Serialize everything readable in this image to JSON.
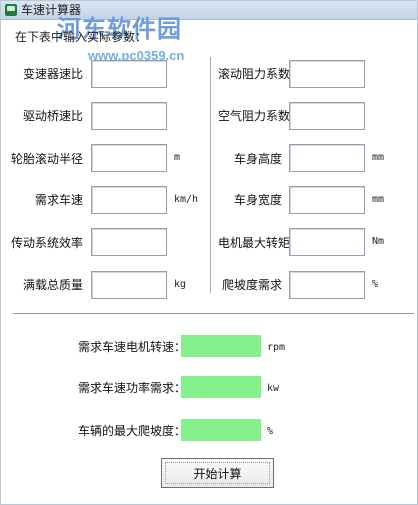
{
  "window": {
    "title": "车速计算器"
  },
  "watermark": {
    "main": "河东软件园",
    "sub": "www.pc0359.cn"
  },
  "section": {
    "title": "在下表中输入实际参数："
  },
  "left_fields": [
    {
      "label": "变速器速比",
      "value": "",
      "unit": ""
    },
    {
      "label": "驱动桥速比",
      "value": "",
      "unit": ""
    },
    {
      "label": "轮胎滚动半径",
      "value": "",
      "unit": "m"
    },
    {
      "label": "需求车速",
      "value": "",
      "unit": "km/h"
    },
    {
      "label": "传动系统效率",
      "value": "",
      "unit": ""
    },
    {
      "label": "满载总质量",
      "value": "",
      "unit": "kg"
    }
  ],
  "right_fields": [
    {
      "label": "滚动阻力系数",
      "value": "",
      "unit": ""
    },
    {
      "label": "空气阻力系数",
      "value": "",
      "unit": ""
    },
    {
      "label": "车身高度",
      "value": "",
      "unit": "mm"
    },
    {
      "label": "车身宽度",
      "value": "",
      "unit": "mm"
    },
    {
      "label": "电机最大转矩",
      "value": "",
      "unit": "Nm"
    },
    {
      "label": "爬坡度需求",
      "value": "",
      "unit": "%"
    }
  ],
  "results": [
    {
      "label": "需求车速电机转速：",
      "value": "",
      "unit": "rpm"
    },
    {
      "label": "需求车速功率需求：",
      "value": "",
      "unit": "kw"
    },
    {
      "label": "车辆的最大爬坡度：",
      "value": "",
      "unit": "%"
    }
  ],
  "actions": {
    "start_label": "开始计算"
  },
  "colors": {
    "result_fill": "#84f18d",
    "watermark": "#4c88d2"
  },
  "icons": {
    "app": "app-icon"
  }
}
